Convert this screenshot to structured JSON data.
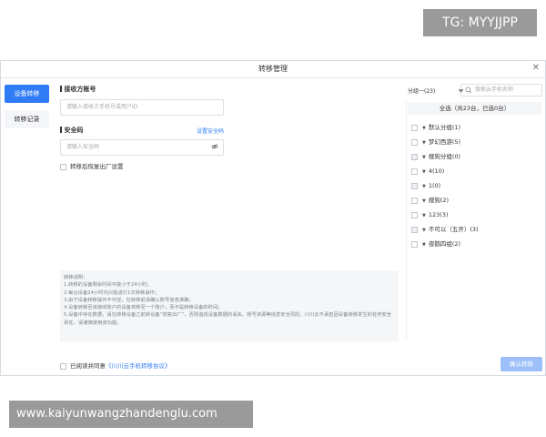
{
  "watermarks": {
    "top": "TG: MYYJJPP",
    "bottom": "www.kaiyunwangzhandenglu.com"
  },
  "dialog": {
    "title": "转移管理"
  },
  "tabs": [
    {
      "label": "设备转移",
      "active": true
    },
    {
      "label": "转移记录",
      "active": false
    }
  ],
  "receiver": {
    "label": "接收方账号",
    "placeholder": "请输入接收方手机号或用户ID"
  },
  "security": {
    "label": "安全码",
    "set_link": "设置安全码",
    "placeholder": "请输入安全码"
  },
  "restore_checkbox_label": "转移后恢复出厂设置",
  "notes": {
    "title": "转移说明：",
    "lines": [
      "1.转移的设备剩余时间不能小于24小时；",
      "2.每台设备24小时内只能进行1次转移操作；",
      "3.由于设备转移操作不可逆，在转移前请确认账号信息准确；",
      "4.设备转移至该接收账户的设备将移至一个账户，而不是转移设备的时间；",
      "5.设备中存在数据，请在转移设备之前转设备“恢复出厂”，否则造成设备数据的丢失、账号资源等信息安全风险，川川云不承担因设备转移发生的任何安全责任，请谨慎使用该功能。"
    ]
  },
  "agreement": {
    "prefix": "已阅读并同意",
    "link": "《川川云手机转移协议》"
  },
  "confirm_button": "确认转移",
  "right": {
    "group_select": "分组一(23)",
    "search_placeholder": "搜索云手机名称",
    "select_all": "全选（共23台，已选0台）",
    "groups": [
      {
        "name": "默认分组(1)",
        "disabled": false
      },
      {
        "name": "梦幻西游(5)",
        "disabled": false
      },
      {
        "name": "搜狗分组(0)",
        "disabled": true
      },
      {
        "name": "4(10)",
        "disabled": false
      },
      {
        "name": "1(0)",
        "disabled": true
      },
      {
        "name": "搜狗(2)",
        "disabled": false
      },
      {
        "name": "123(3)",
        "disabled": false
      },
      {
        "name": "不可以（五开）(3)",
        "disabled": true
      },
      {
        "name": "夜鹅四组(2)",
        "disabled": false
      }
    ]
  },
  "colors": {
    "accent": "#2f7cf6",
    "confirm_disabled": "#9cc0f7",
    "panel_bg": "#f5f6f8"
  }
}
